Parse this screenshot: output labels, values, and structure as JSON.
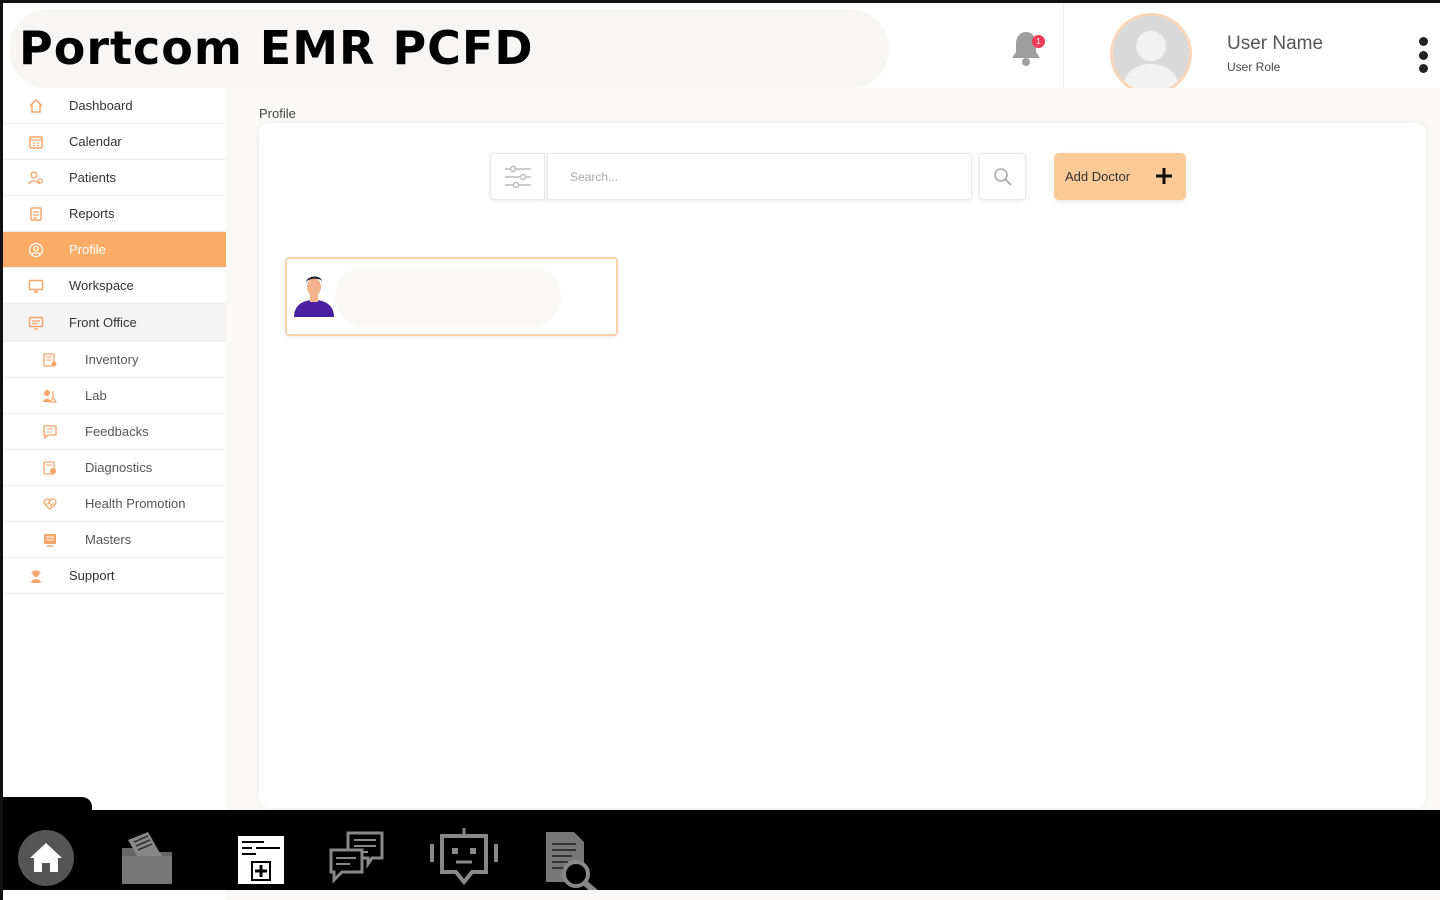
{
  "header": {
    "app_title": "Portcom EMR PCFD",
    "notification_count": "1",
    "user_name": "User Name",
    "user_role": "User Role"
  },
  "sidebar": {
    "items": [
      {
        "label": "Dashboard",
        "icon": "home-icon"
      },
      {
        "label": "Calendar",
        "icon": "calendar-icon"
      },
      {
        "label": "Patients",
        "icon": "patients-icon"
      },
      {
        "label": "Reports",
        "icon": "reports-icon"
      },
      {
        "label": "Profile",
        "icon": "profile-icon",
        "active": true
      },
      {
        "label": "Workspace",
        "icon": "monitor-icon"
      },
      {
        "label": "Front Office",
        "icon": "front-office-icon"
      },
      {
        "label": "Inventory",
        "icon": "inventory-icon",
        "sub": true
      },
      {
        "label": "Lab",
        "icon": "lab-icon",
        "sub": true
      },
      {
        "label": "Feedbacks",
        "icon": "feedback-icon",
        "sub": true
      },
      {
        "label": "Diagnostics",
        "icon": "diagnostics-icon",
        "sub": true
      },
      {
        "label": "Health Promotion",
        "icon": "health-promotion-icon",
        "sub": true
      },
      {
        "label": "Masters",
        "icon": "masters-icon",
        "sub": true
      },
      {
        "label": "Support",
        "icon": "support-icon"
      }
    ]
  },
  "main": {
    "breadcrumb": "Profile",
    "search": {
      "placeholder": "Search..."
    },
    "add_button_label": "Add Doctor"
  },
  "colors": {
    "accent": "#fbac66",
    "button": "#fcca96",
    "badge": "#ef3b56",
    "icon": "#f5a56a"
  },
  "dock": {
    "items": [
      "home-icon",
      "documents-icon",
      "medical-record-icon",
      "chat-icon",
      "bot-icon",
      "document-search-icon"
    ]
  }
}
